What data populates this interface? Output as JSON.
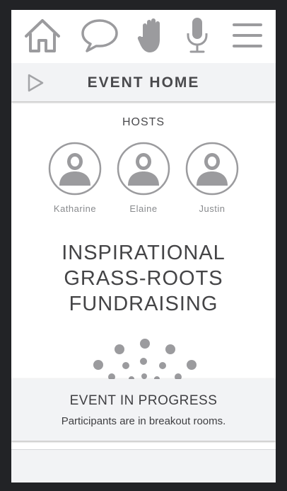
{
  "nav": {
    "icons": [
      "home-icon",
      "chat-bubble-icon",
      "raise-hand-icon",
      "microphone-icon",
      "menu-icon"
    ]
  },
  "header": {
    "title": "EVENT HOME",
    "icon": "play-icon"
  },
  "hosts": {
    "title": "HOSTS",
    "people": [
      {
        "name": "Katharine"
      },
      {
        "name": "Elaine"
      },
      {
        "name": "Justin"
      }
    ]
  },
  "event": {
    "title_lines": [
      "INSPIRATIONAL",
      "GRASS-ROOTS",
      "FUNDRAISING"
    ]
  },
  "status": {
    "title": "EVENT IN PROGRESS",
    "subtitle": "Participants are in breakout rooms."
  },
  "colors": {
    "icon_gray": "#9b9b9e",
    "text_dark": "#444446",
    "panel_bg": "#f2f3f5",
    "frame": "#222326"
  }
}
